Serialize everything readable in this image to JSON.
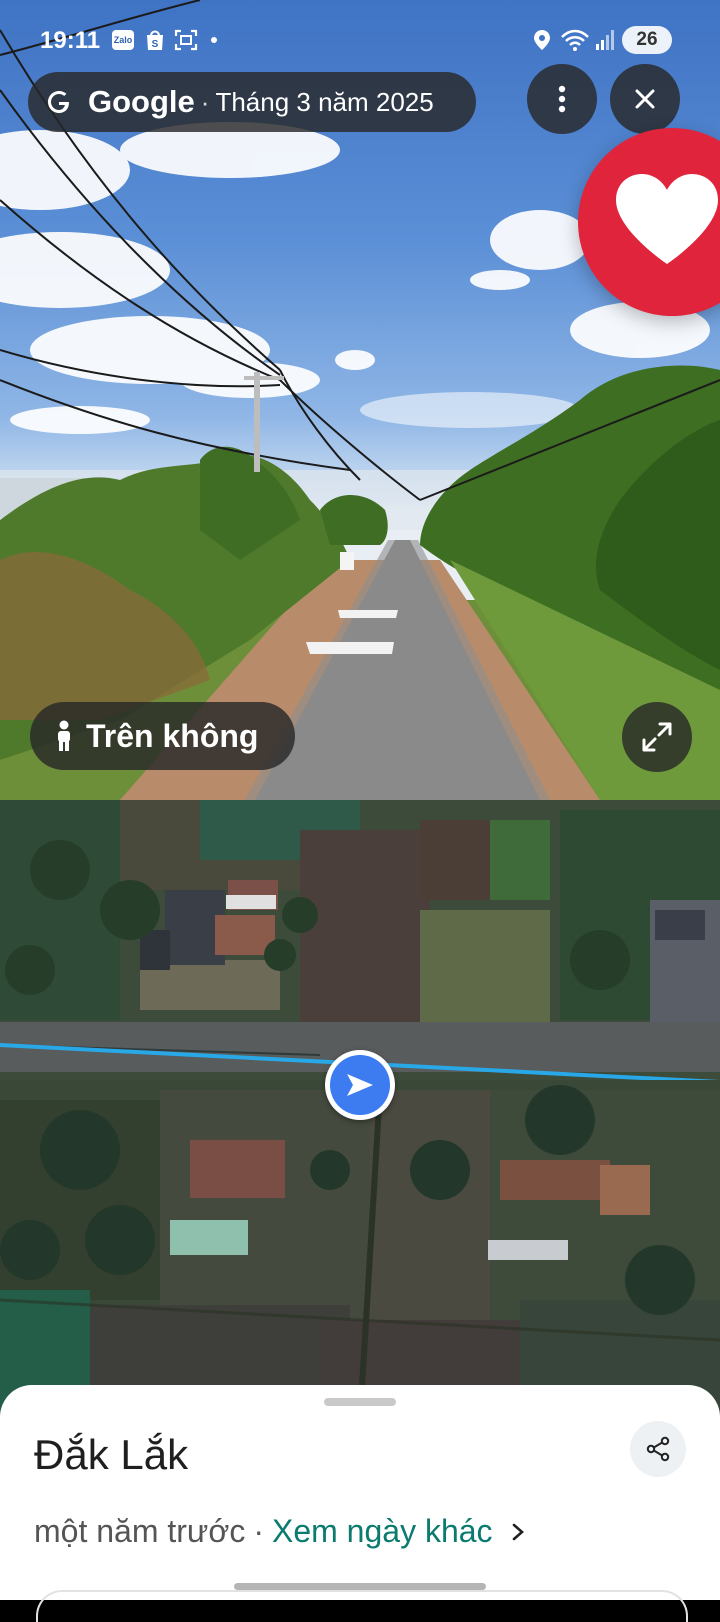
{
  "status_bar": {
    "time": "19:11",
    "app_icons": [
      "Zalo",
      "shopee-icon",
      "screenshot-icon"
    ],
    "battery": "26"
  },
  "header": {
    "brand": "Google",
    "separator": "·",
    "date": "Tháng 3 năm 2025"
  },
  "street_view": {
    "aerial_label": "Trên không",
    "icons": [
      "more-vert-icon",
      "close-icon",
      "heart-icon",
      "person-icon",
      "expand-icon"
    ]
  },
  "map": {
    "arrow_icon": "navigation-arrow-icon"
  },
  "sheet": {
    "title": "Đắk Lắk",
    "time_ago": "một năm trước",
    "separator": "·",
    "other_dates_link": "Xem ngày khác"
  },
  "colors": {
    "accent_blue": "#3c7bf0",
    "link_teal": "#0b7a6f",
    "heart_red": "#e0243c",
    "pill_bg": "#282828"
  }
}
